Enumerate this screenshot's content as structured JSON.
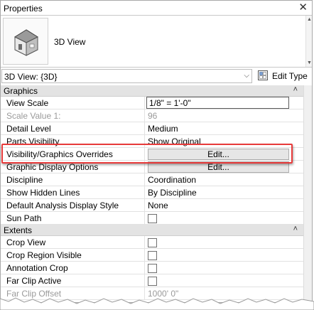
{
  "window": {
    "title": "Properties",
    "close_glyph": "✕"
  },
  "type_selector": {
    "type_name": "3D View",
    "icon": "house-3d-icon"
  },
  "instance_selector": {
    "selected": "3D View: {3D}",
    "edit_type_label": "Edit Type"
  },
  "groups": [
    {
      "label": "Graphics",
      "rows": [
        {
          "name": "View Scale",
          "value": "1/8\" = 1'-0\"",
          "kind": "input"
        },
        {
          "name": "Scale Value    1:",
          "value": "96",
          "kind": "text",
          "disabled": true
        },
        {
          "name": "Detail Level",
          "value": "Medium",
          "kind": "text"
        },
        {
          "name": "Parts Visibility",
          "value": "Show Original",
          "kind": "text"
        },
        {
          "name": "Visibility/Graphics Overrides",
          "value": "Edit...",
          "kind": "button"
        },
        {
          "name": "Graphic Display Options",
          "value": "Edit...",
          "kind": "button"
        },
        {
          "name": "Discipline",
          "value": "Coordination",
          "kind": "text"
        },
        {
          "name": "Show Hidden Lines",
          "value": "By Discipline",
          "kind": "text"
        },
        {
          "name": "Default Analysis Display Style",
          "value": "None",
          "kind": "text"
        },
        {
          "name": "Sun Path",
          "value": "",
          "kind": "checkbox"
        }
      ]
    },
    {
      "label": "Extents",
      "rows": [
        {
          "name": "Crop View",
          "value": "",
          "kind": "checkbox"
        },
        {
          "name": "Crop Region Visible",
          "value": "",
          "kind": "checkbox"
        },
        {
          "name": "Annotation Crop",
          "value": "",
          "kind": "checkbox"
        },
        {
          "name": "Far Clip Active",
          "value": "",
          "kind": "checkbox"
        },
        {
          "name": "Far Clip Offset",
          "value": "1000'  0\"",
          "kind": "text",
          "disabled": true
        }
      ]
    }
  ],
  "highlight": {
    "row": "Visibility/Graphics Overrides",
    "color": "#e83b3b"
  },
  "colors": {
    "group_header_bg": "#e3e3e3",
    "grid_line": "#e2e2e2",
    "disabled_text": "#9a9a9a"
  }
}
